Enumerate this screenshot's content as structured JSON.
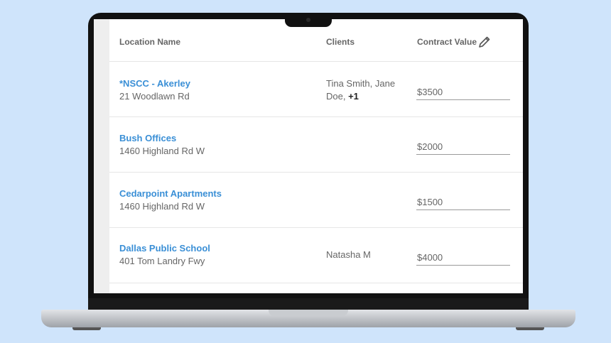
{
  "table": {
    "headers": {
      "location": "Location Name",
      "clients": "Clients",
      "contract_value": "Contract Value"
    },
    "rows": [
      {
        "name": "*NSCC - Akerley",
        "address": "21 Woodlawn Rd",
        "clients": "Tina Smith, Jane Doe, ",
        "clients_more": "+1",
        "value": "$3500"
      },
      {
        "name": "Bush Offices",
        "address": "1460 Highland Rd W",
        "clients": "",
        "clients_more": "",
        "value": "$2000"
      },
      {
        "name": "Cedarpoint Apartments",
        "address": "1460 Highland Rd W",
        "clients": "",
        "clients_more": "",
        "value": "$1500"
      },
      {
        "name": "Dallas Public School",
        "address": "401 Tom Landry Fwy",
        "clients": "Natasha M",
        "clients_more": "",
        "value": "$4000"
      }
    ]
  },
  "icons": {
    "edit": "pencil-icon",
    "camera": "camera-icon"
  },
  "colors": {
    "background": "#cfe4fb",
    "link": "#3a8fd6",
    "text": "#666666"
  }
}
